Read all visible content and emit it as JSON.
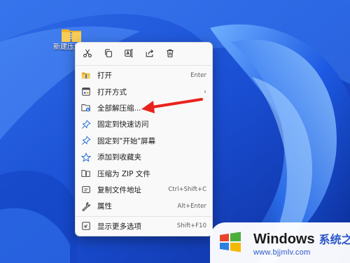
{
  "desktop": {
    "folder_label": "新建压缩(zipped)"
  },
  "context_menu": {
    "toolbar": [
      {
        "name": "cut",
        "icon": "scissors-icon"
      },
      {
        "name": "copy",
        "icon": "copy-icon"
      },
      {
        "name": "rename",
        "icon": "rename-icon"
      },
      {
        "name": "share",
        "icon": "share-icon"
      },
      {
        "name": "delete",
        "icon": "trash-icon"
      }
    ],
    "items": [
      {
        "label": "打开",
        "shortcut": "Enter",
        "icon": "folder-open-icon"
      },
      {
        "label": "打开方式",
        "shortcut": "",
        "icon": "open-with-icon",
        "submenu": true
      },
      {
        "label": "全部解压缩...",
        "shortcut": "",
        "icon": "extract-all-icon"
      },
      {
        "label": "固定到快速访问",
        "shortcut": "",
        "icon": "pin-icon"
      },
      {
        "label": "固定到\"开始\"屏幕",
        "shortcut": "",
        "icon": "pin-start-icon"
      },
      {
        "label": "添加到收藏夹",
        "shortcut": "",
        "icon": "star-icon"
      },
      {
        "label": "压缩为 ZIP 文件",
        "shortcut": "",
        "icon": "zip-icon"
      },
      {
        "label": "复制文件地址",
        "shortcut": "Ctrl+Shift+C",
        "icon": "copy-path-icon"
      },
      {
        "label": "属性",
        "shortcut": "Alt+Enter",
        "icon": "wrench-icon"
      },
      {
        "label": "显示更多选项",
        "shortcut": "Shift+F10",
        "icon": "more-options-icon"
      }
    ],
    "submenu_glyph": "›"
  },
  "watermark": {
    "brand": "Windows",
    "brand_cn": "系统之家",
    "url": "www.bjjmlv.com"
  },
  "colors": {
    "accent_arrow": "#e8231d",
    "menu_bg": "#f9f9f9",
    "folder_yellow": "#f5c542"
  }
}
